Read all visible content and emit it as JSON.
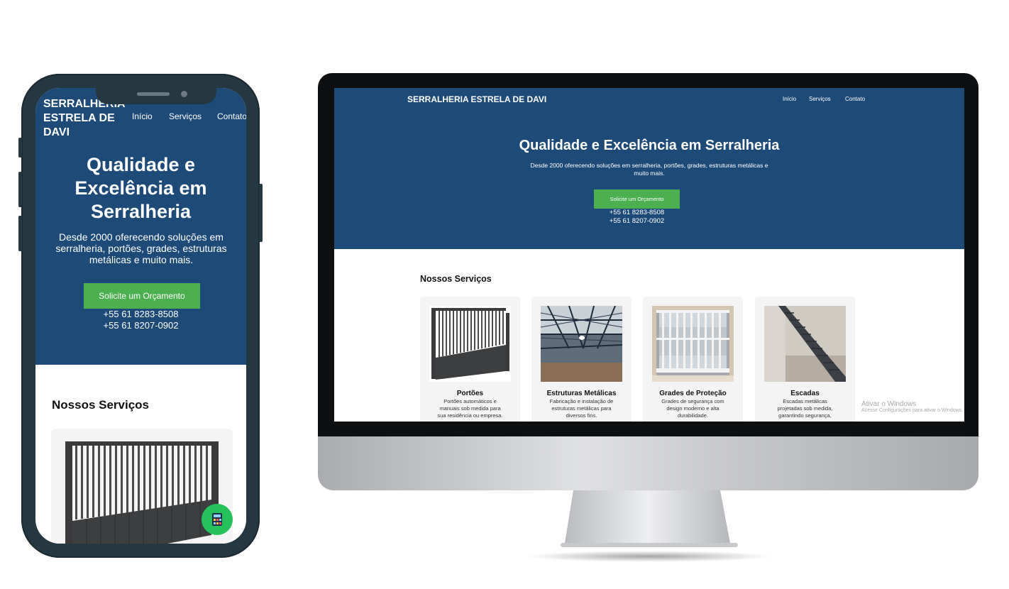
{
  "brand": "SERRALHERIA ESTRELA DE DAVI",
  "mobile_brand_lines": [
    "SERRALHERIA",
    "ESTRELA DE",
    "DAVI"
  ],
  "nav": [
    "Início",
    "Serviços",
    "Contato"
  ],
  "mobile_nav_contato": "Contato",
  "hero": {
    "title": "Qualidade e Excelência em Serralheria",
    "mobile_title_lines": [
      "Qualidade e",
      "Excelência em",
      "Serralheria"
    ],
    "subtitle": "Desde 2000 oferecendo soluções em serralheria, portões, grades, estruturas metálicas e muito mais.",
    "mobile_subtitle_lines": [
      "Desde 2000 oferecendo soluções em",
      "serralheria, portões, grades, estruturas",
      "metálicas e muito mais."
    ],
    "desktop_subtitle_lines": [
      "Desde 2000 oferecendo soluções em serralheria, portões, grades, estruturas metálicas e",
      "muito mais."
    ],
    "cta": "Solicite um Orçamento",
    "phones": [
      "+55 61 8283-8508",
      "+55 61 8207-0902"
    ]
  },
  "services": {
    "title": "Nossos Serviços",
    "items": [
      {
        "name": "Portões",
        "desc_lines": [
          "Portões automáticos e",
          "manuais sob medida para",
          "sua residência ou empresa."
        ],
        "icon": "gate-photo"
      },
      {
        "name": "Estruturas Metálicas",
        "desc_lines": [
          "Fabricação e instalação de",
          "estruturas metálicas para",
          "diversos fins."
        ],
        "icon": "steel-roof-photo"
      },
      {
        "name": "Grades de Proteção",
        "desc_lines": [
          "Grades de segurança com",
          "design moderno e alta",
          "durabilidade."
        ],
        "icon": "window-grille-photo"
      },
      {
        "name": "Escadas",
        "desc_lines": [
          "Escadas metálicas",
          "projetadas sob medida,",
          "garantindo segurança,"
        ],
        "icon": "staircase-photo"
      }
    ]
  },
  "windows_activation": {
    "title": "Ativar o Windows",
    "subtitle": "Acesse Configurações para ativar o Windows."
  },
  "colors": {
    "hero_bg": "#1e4a78",
    "cta_bg": "#4caf50",
    "fab_bg": "#25c15a",
    "device_frame": "#253740"
  },
  "fab_icon": "calculator-icon"
}
